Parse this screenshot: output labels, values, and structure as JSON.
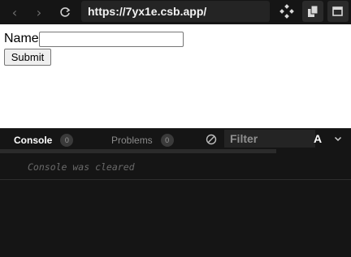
{
  "browser": {
    "url": "https://7yx1e.csb.app/"
  },
  "preview": {
    "name_label": "Name",
    "name_value": "",
    "submit_label": "Submit"
  },
  "devtools": {
    "tabs": [
      {
        "label": "Console",
        "count": "0",
        "active": true
      },
      {
        "label": "Problems",
        "count": "0",
        "active": false
      }
    ],
    "filter_placeholder": "Filter",
    "font_toggle": "A",
    "messages": [
      "Console was cleared"
    ]
  },
  "icons": {
    "back": "back-icon",
    "forward": "forward-icon",
    "reload": "reload-icon",
    "toolbar": [
      "codesandbox-icon",
      "copy-icon",
      "open-window-icon"
    ],
    "clear": "clear-console-icon",
    "chevron": "chevron-down-icon"
  },
  "colors": {
    "background": "#151515",
    "preview_background": "#ffffff",
    "active_tab_text": "#ffffff",
    "inactive_tab_text": "#8a8a8a",
    "console_message": "#6a6a6a"
  }
}
